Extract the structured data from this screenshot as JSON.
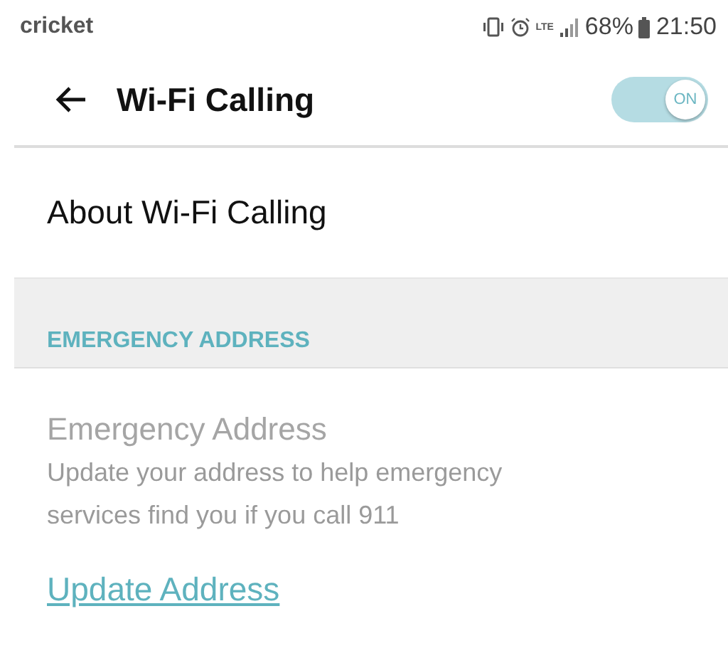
{
  "status_bar": {
    "carrier": "cricket",
    "network": "LTE",
    "battery": "68%",
    "time": "21:50"
  },
  "header": {
    "title": "Wi-Fi Calling",
    "toggle": {
      "label": "ON",
      "on": true
    }
  },
  "items": [
    {
      "kind": "link-row",
      "title": "About Wi-Fi Calling"
    }
  ],
  "section": {
    "heading": "EMERGENCY ADDRESS",
    "item": {
      "title": "Emergency Address",
      "subtitle": "Update your address to help emergency services find you if you call 911",
      "disabled": true
    },
    "link": "Update Address"
  }
}
